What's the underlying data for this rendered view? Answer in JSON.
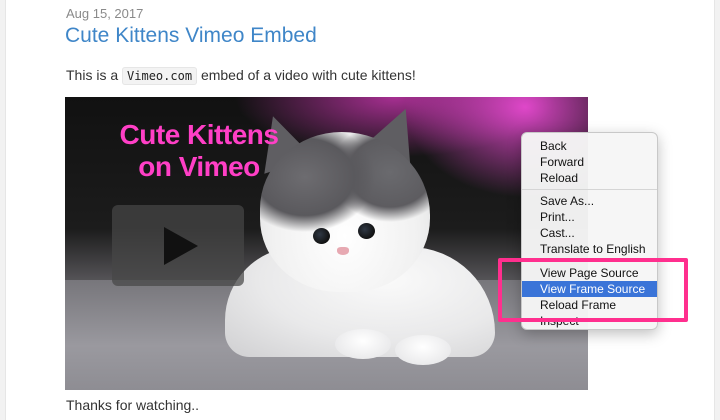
{
  "post": {
    "date": "Aug 15, 2017",
    "title": "Cute Kittens Vimeo Embed",
    "intro_before": "This is a ",
    "intro_code": "Vimeo.com",
    "intro_after": " embed of a video with cute kittens!",
    "outro": "Thanks for watching.."
  },
  "video": {
    "title_line1": "Cute Kittens",
    "title_line2": "on Vimeo",
    "title_color": "#ff3fc6",
    "play_icon": "play-icon"
  },
  "context_menu": {
    "items": [
      {
        "label": "Back"
      },
      {
        "label": "Forward"
      },
      {
        "label": "Reload"
      },
      {
        "label": "Save As..."
      },
      {
        "label": "Print..."
      },
      {
        "label": "Cast..."
      },
      {
        "label": "Translate to English"
      },
      {
        "label": "View Page Source"
      },
      {
        "label": "View Frame Source",
        "selected": true
      },
      {
        "label": "Reload Frame"
      },
      {
        "label": "Inspect"
      }
    ],
    "selection_color": "#3a74d8",
    "highlight_color": "#ff2f8e"
  },
  "colors": {
    "link": "#3f86c8",
    "date": "#8a8a8a",
    "text": "#333333"
  }
}
